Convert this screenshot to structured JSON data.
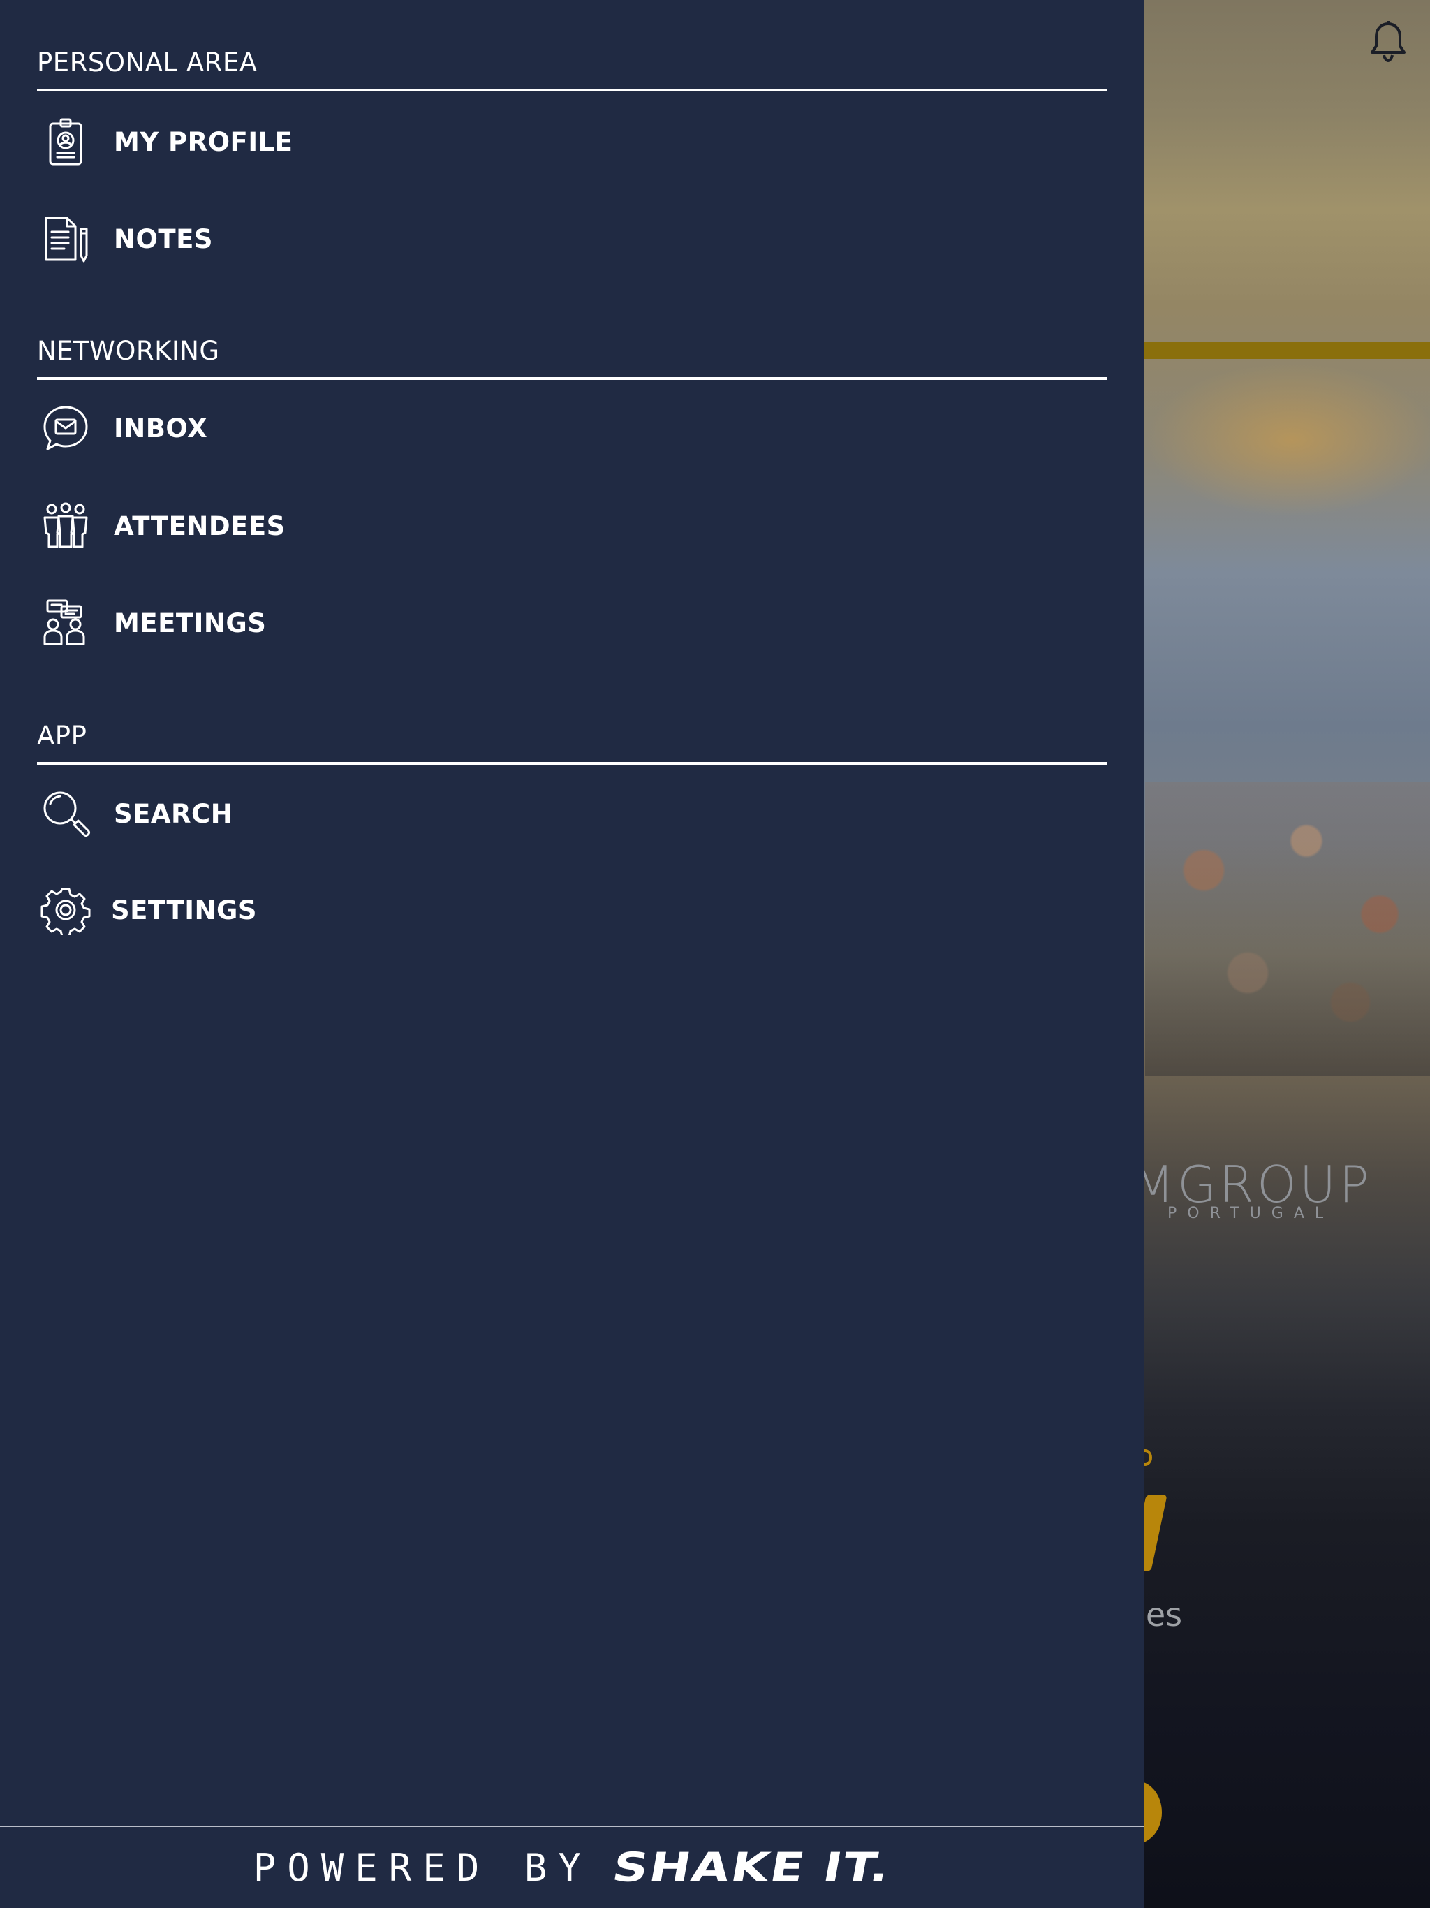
{
  "drawer": {
    "sections": [
      {
        "title": "PERSONAL AREA",
        "items": [
          {
            "label": "MY PROFILE",
            "icon": "id-badge-icon"
          },
          {
            "label": "NOTES",
            "icon": "notes-icon"
          }
        ]
      },
      {
        "title": "NETWORKING",
        "items": [
          {
            "label": "INBOX",
            "icon": "inbox-icon"
          },
          {
            "label": "ATTENDEES",
            "icon": "attendees-icon"
          },
          {
            "label": "MEETINGS",
            "icon": "meetings-icon"
          }
        ]
      },
      {
        "title": "APP",
        "items": [
          {
            "label": "SEARCH",
            "icon": "search-icon"
          },
          {
            "label": "SETTINGS",
            "icon": "gear-icon"
          }
        ]
      }
    ],
    "footer": {
      "powered_by": "POWERED BY",
      "brand": "SHAKE IT."
    }
  },
  "background_app": {
    "logo_text": "MGROUP",
    "logo_subtext": "PORTUGAL",
    "partial_text": "ties",
    "notification_icon": "bell-icon"
  },
  "colors": {
    "drawer_background": "#202a43",
    "text": "#ffffff",
    "accent_yellow": "#b8860b"
  }
}
